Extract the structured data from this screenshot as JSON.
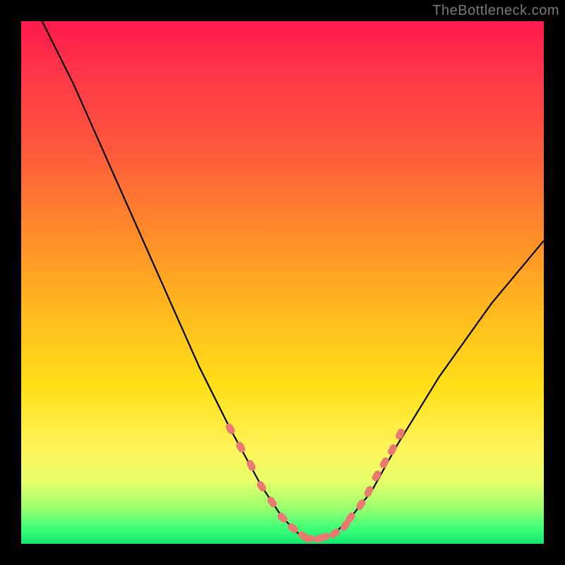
{
  "watermark": "TheBottleneck.com",
  "chart_data": {
    "type": "line",
    "title": "",
    "xlabel": "",
    "ylabel": "",
    "xlim": [
      0,
      100
    ],
    "ylim": [
      0,
      100
    ],
    "series": [
      {
        "name": "curve",
        "x": [
          4,
          10,
          18,
          26,
          34,
          40,
          46,
          50,
          53,
          55,
          57,
          60,
          63,
          67,
          72,
          80,
          90,
          100
        ],
        "y": [
          100,
          88,
          70,
          52,
          34,
          22,
          11,
          5,
          2,
          1,
          1,
          2,
          5,
          10,
          19,
          32,
          46,
          58
        ]
      }
    ],
    "highlight_segments": [
      {
        "name": "left-dots",
        "x": [
          40,
          42,
          44,
          46,
          48,
          50,
          52,
          54
        ],
        "y": [
          22,
          18.5,
          15,
          11,
          8,
          5,
          3,
          1.5
        ]
      },
      {
        "name": "bottom-dots",
        "x": [
          55,
          57,
          58,
          60,
          62,
          63
        ],
        "y": [
          1,
          1,
          1.3,
          2,
          3.5,
          5
        ]
      },
      {
        "name": "right-dots",
        "x": [
          65,
          66.5,
          68,
          69.5,
          71,
          72.5
        ],
        "y": [
          7.5,
          10,
          13,
          15.5,
          18,
          21
        ]
      }
    ],
    "colors": {
      "curve": "#000000",
      "highlight": "#e97a72",
      "gradient_top": "#ff1a4e",
      "gradient_bottom": "#13e86e"
    }
  }
}
